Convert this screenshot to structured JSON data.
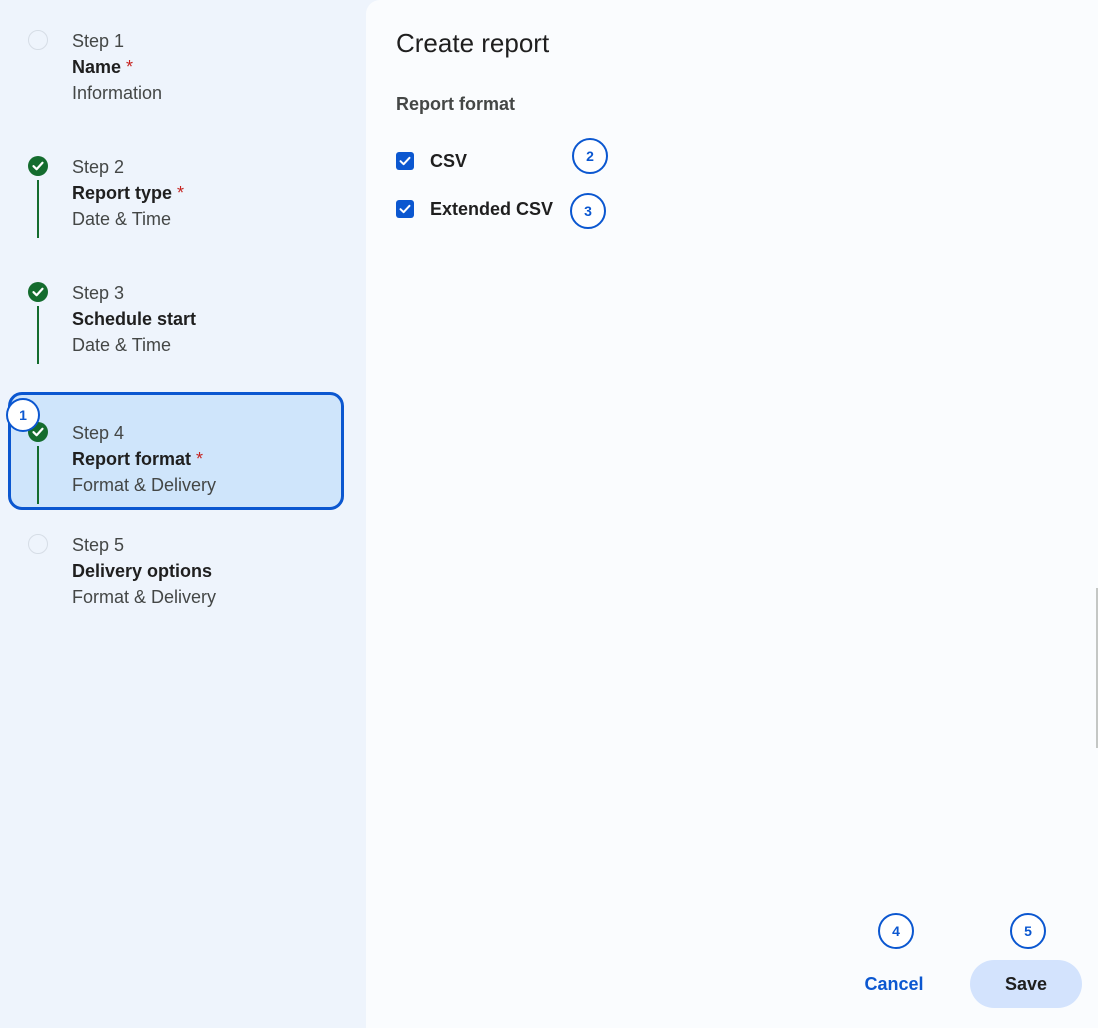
{
  "sidebar": {
    "steps": [
      {
        "number": "Step 1",
        "title": "Name",
        "required": "*",
        "subtitle": "Information",
        "status": "pending"
      },
      {
        "number": "Step 2",
        "title": "Report type",
        "required": "*",
        "subtitle": "Date & Time",
        "status": "done"
      },
      {
        "number": "Step 3",
        "title": "Schedule start",
        "required": "",
        "subtitle": "Date & Time",
        "status": "done"
      },
      {
        "number": "Step 4",
        "title": "Report format",
        "required": "*",
        "subtitle": "Format & Delivery",
        "status": "active"
      },
      {
        "number": "Step 5",
        "title": "Delivery options",
        "required": "",
        "subtitle": "Format & Delivery",
        "status": "pending"
      }
    ]
  },
  "main": {
    "title": "Create report",
    "section_label": "Report format",
    "options": [
      {
        "label": "CSV",
        "checked": true
      },
      {
        "label": "Extended CSV",
        "checked": true
      }
    ]
  },
  "footer": {
    "cancel_label": "Cancel",
    "save_label": "Save"
  },
  "badges": [
    "1",
    "2",
    "3",
    "4",
    "5"
  ],
  "colors": {
    "accent": "#0b57d0",
    "done": "#146c2e",
    "required": "#c5221f",
    "active_bg": "#cfe5fb",
    "save_bg": "#d3e3fd"
  }
}
